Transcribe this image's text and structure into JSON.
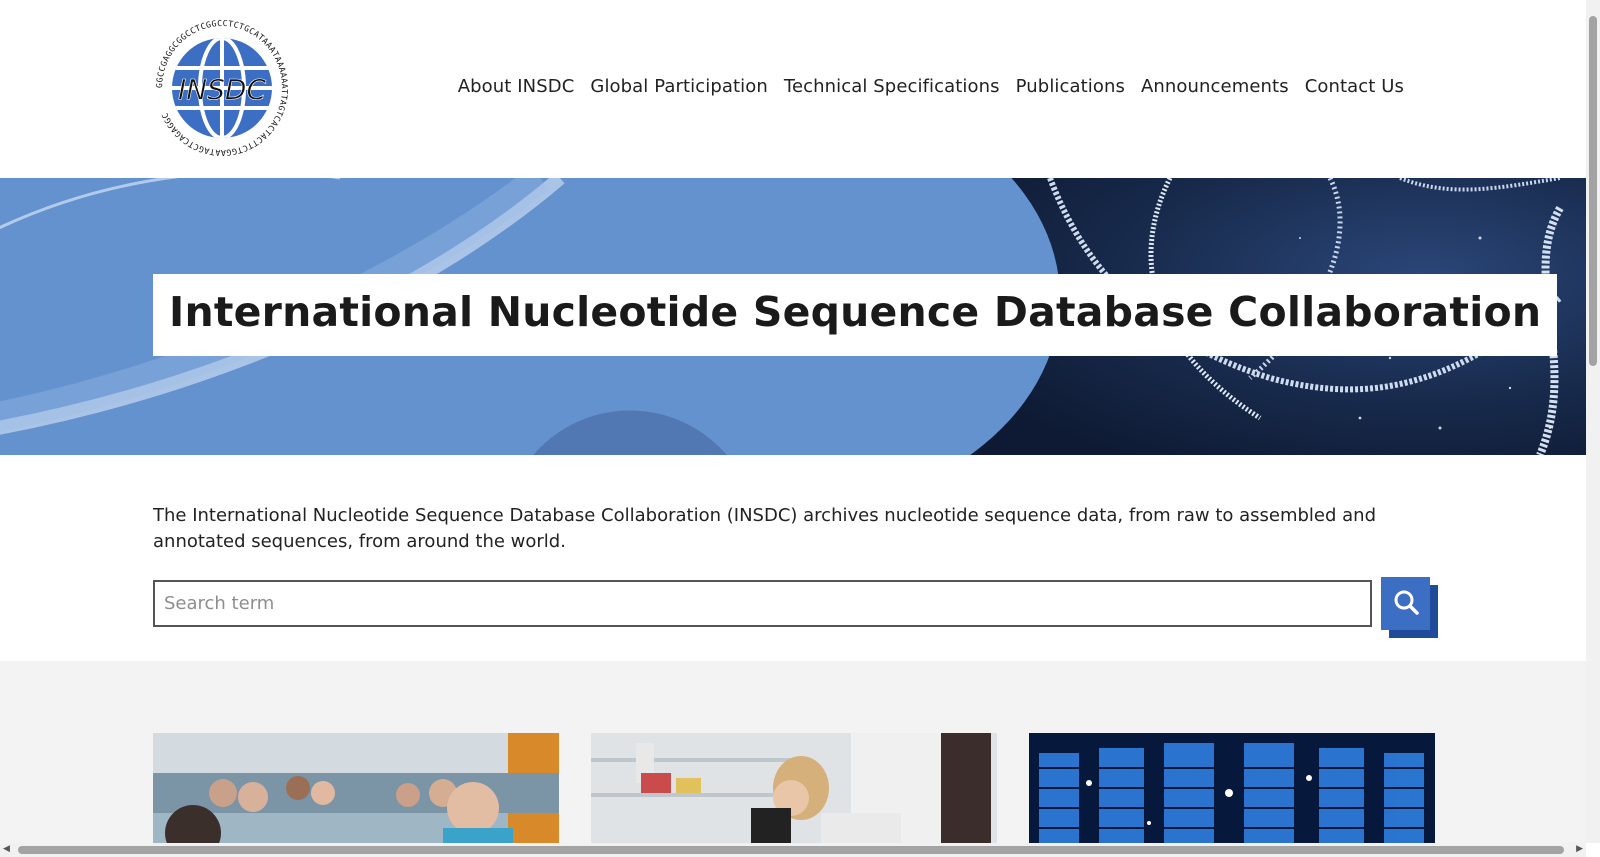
{
  "header": {
    "logo": {
      "text": "INSDC",
      "ring_text": "GGCCGAGGCGGCCTCGGCCTCTGCATAAATAAAAAATTAGTCACTACTTCTGGAATAGCTCAGAGGC"
    },
    "nav": [
      {
        "label": "About INSDC"
      },
      {
        "label": "Global Participation"
      },
      {
        "label": "Technical Specifications"
      },
      {
        "label": "Publications"
      },
      {
        "label": "Announcements"
      },
      {
        "label": "Contact Us"
      }
    ]
  },
  "hero": {
    "title": "International Nucleotide Sequence Database Collaboration"
  },
  "intro": {
    "text": "The International Nucleotide Sequence Database Collaboration (INSDC) archives nucleotide sequence data, from raw to assembled and annotated sequences, from around the world."
  },
  "search": {
    "placeholder": "Search term",
    "value": "",
    "button_icon": "search-icon"
  },
  "cards": [
    {
      "image": "team-photo"
    },
    {
      "image": "lab-microscope-photo"
    },
    {
      "image": "data-center-photo"
    }
  ],
  "colors": {
    "brand_blue": "#3c6fc4",
    "brand_dark_blue": "#1f4b99",
    "hero_blue": "#6392cf",
    "hero_dark": "#16284a",
    "section_grey": "#f3f3f3"
  }
}
